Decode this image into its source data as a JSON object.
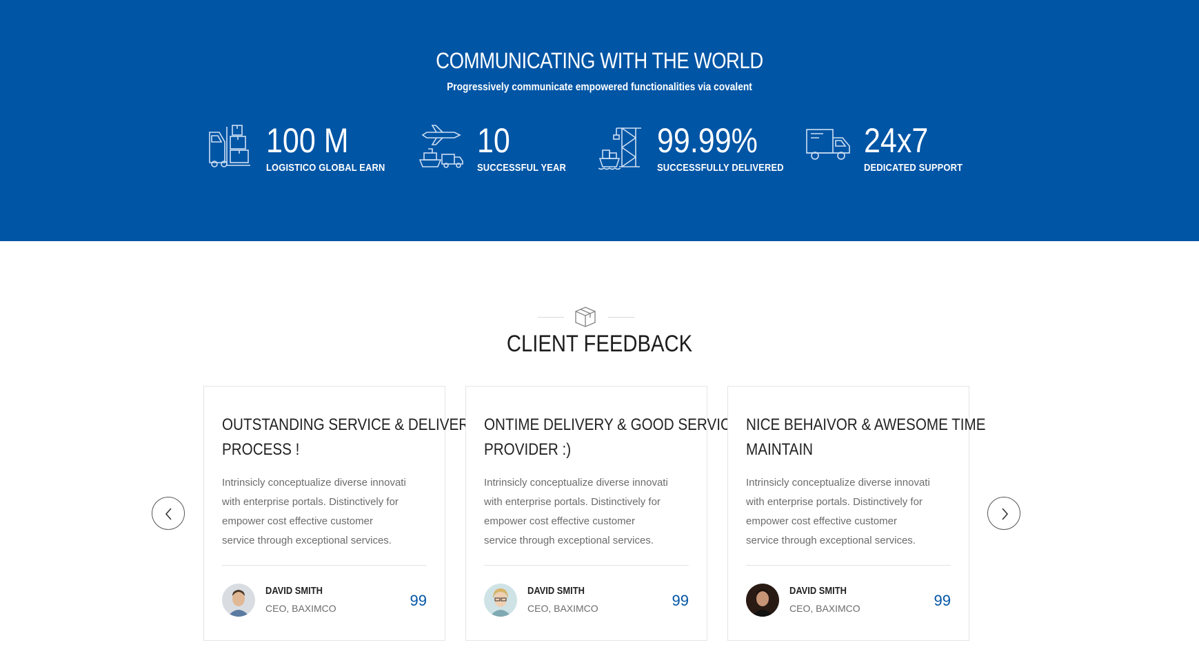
{
  "stats_band": {
    "title": "COMMUNICATING WITH THE WORLD",
    "subtitle": "Progressively communicate empowered functionalities via covalent",
    "stats": [
      {
        "value": "100 M",
        "label": "LOGISTICO GLOBAL EARN",
        "icon": "forklift-boxes-icon"
      },
      {
        "value": "10",
        "label": "SUCCESSFUL YEAR",
        "icon": "plane-ship-truck-icon"
      },
      {
        "value": "99.99%",
        "label": "SUCCESSFULLY DELIVERED",
        "icon": "port-crane-icon"
      },
      {
        "value": "24x7",
        "label": "DEDICATED SUPPORT",
        "icon": "delivery-truck-icon"
      }
    ],
    "background_color": "#0155a5"
  },
  "feedback": {
    "title": "CLIENT FEEDBACK",
    "ornament_icon": "package-box-icon",
    "cards": [
      {
        "title_lines": [
          "OUTSTANDING SERVICE & DELIVER",
          "PROCESS !"
        ],
        "text_lines": [
          "Intrinsicly conceptualize diverse innovati",
          "with enterprise portals. Distinctively for",
          "empower cost effective customer",
          "service through exceptional services."
        ],
        "name": "DAVID SMITH",
        "role": "CEO, BAXIMCO",
        "quote": "99",
        "avatar_icon": "man-avatar-icon"
      },
      {
        "title_lines": [
          "ONTIME DELIVERY & GOOD SERVICE",
          "PROVIDER :)"
        ],
        "text_lines": [
          "Intrinsicly conceptualize diverse innovati",
          "with enterprise portals. Distinctively for",
          "empower cost effective customer",
          "service through exceptional services."
        ],
        "name": "DAVID SMITH",
        "role": "CEO, BAXIMCO",
        "quote": "99",
        "avatar_icon": "woman-avatar-icon"
      },
      {
        "title_lines": [
          "NICE BEHAIVOR & AWESOME TIME",
          "MAINTAIN"
        ],
        "text_lines": [
          "Intrinsicly conceptualize diverse innovati",
          "with enterprise portals. Distinctively for",
          "empower cost effective customer",
          "service through exceptional services."
        ],
        "name": "DAVID SMITH",
        "role": "CEO, BAXIMCO",
        "quote": "99",
        "avatar_icon": "man-avatar-icon"
      }
    ],
    "prev_icon": "chevron-left-icon",
    "next_icon": "chevron-right-icon",
    "accent_color": "#0155a5"
  }
}
